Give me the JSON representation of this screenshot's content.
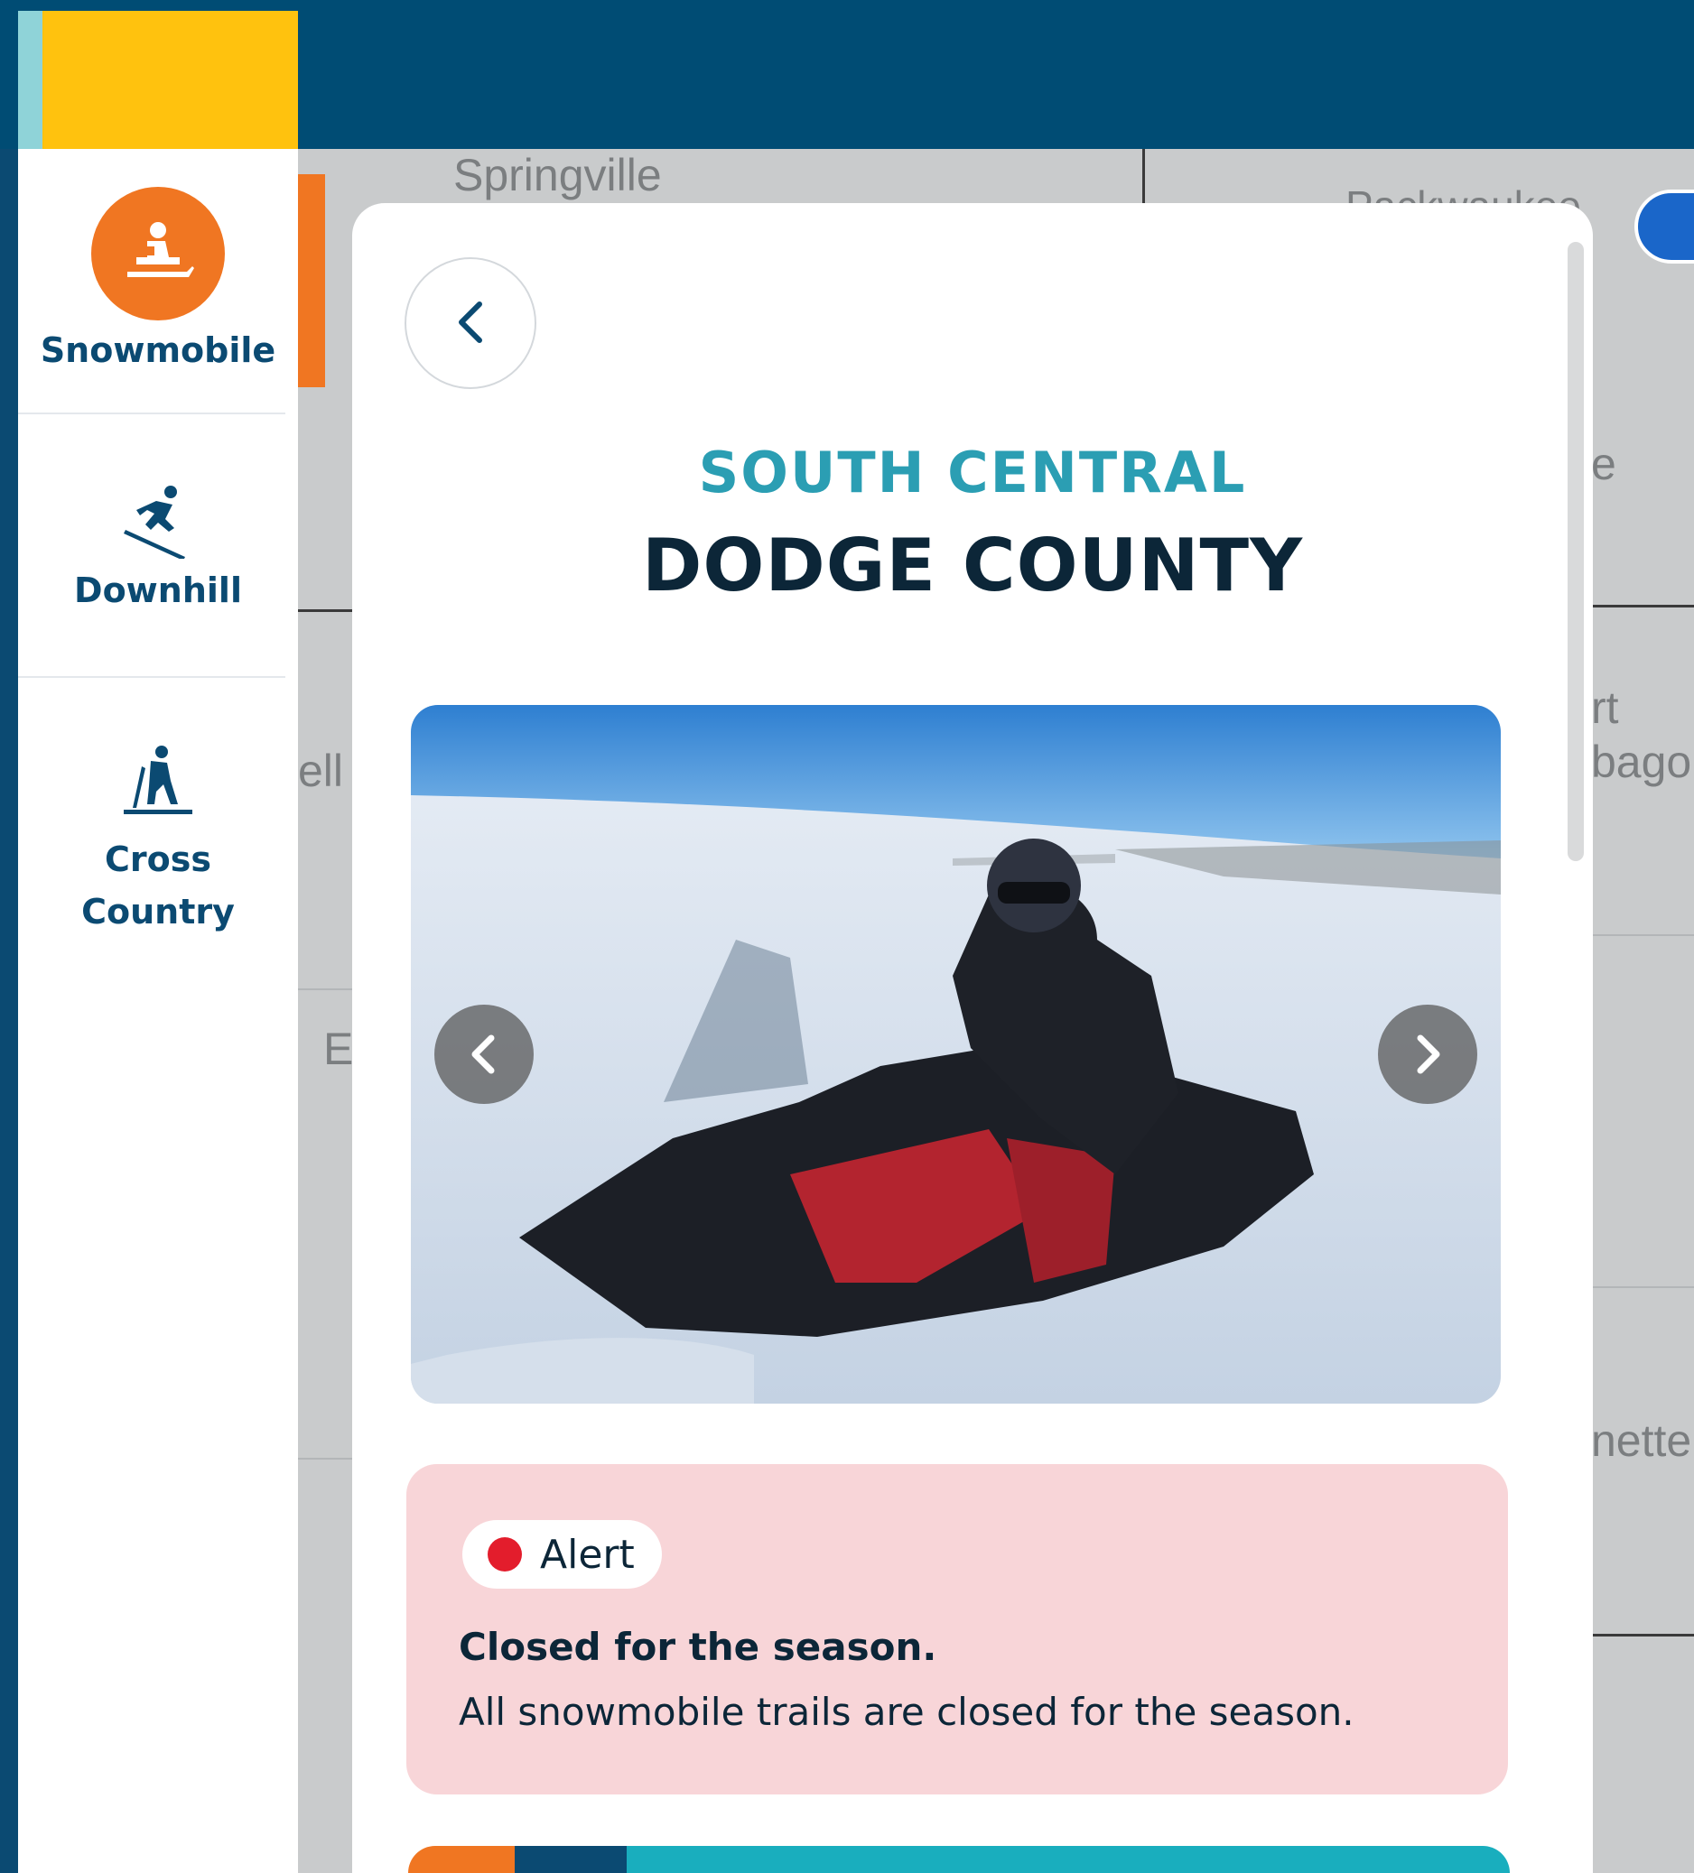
{
  "colors": {
    "header": "#004c74",
    "logo_yellow": "#ffc20e",
    "accent_orange": "#f07622",
    "region_teal": "#2b9eb3",
    "alert_bg": "#f8d5d8",
    "alert_dot": "#e31d2c"
  },
  "sidebar": {
    "items": [
      {
        "label": "Snowmobile",
        "icon": "snowmobile-icon",
        "active": true
      },
      {
        "label": "Downhill",
        "icon": "downhill-skier-icon",
        "active": false
      },
      {
        "label_line1": "Cross",
        "label_line2": "Country",
        "icon": "cross-country-skier-icon",
        "active": false
      }
    ]
  },
  "map": {
    "labels": [
      "Springville",
      "Packwaukee",
      "e",
      "rt",
      "bago",
      "ell",
      "E",
      "nette"
    ]
  },
  "panel": {
    "region": "SOUTH CENTRAL",
    "county": "DODGE COUNTY",
    "alert": {
      "badge": "Alert",
      "title": "Closed for the season.",
      "body": "All snowmobile trails are closed for the season."
    }
  }
}
